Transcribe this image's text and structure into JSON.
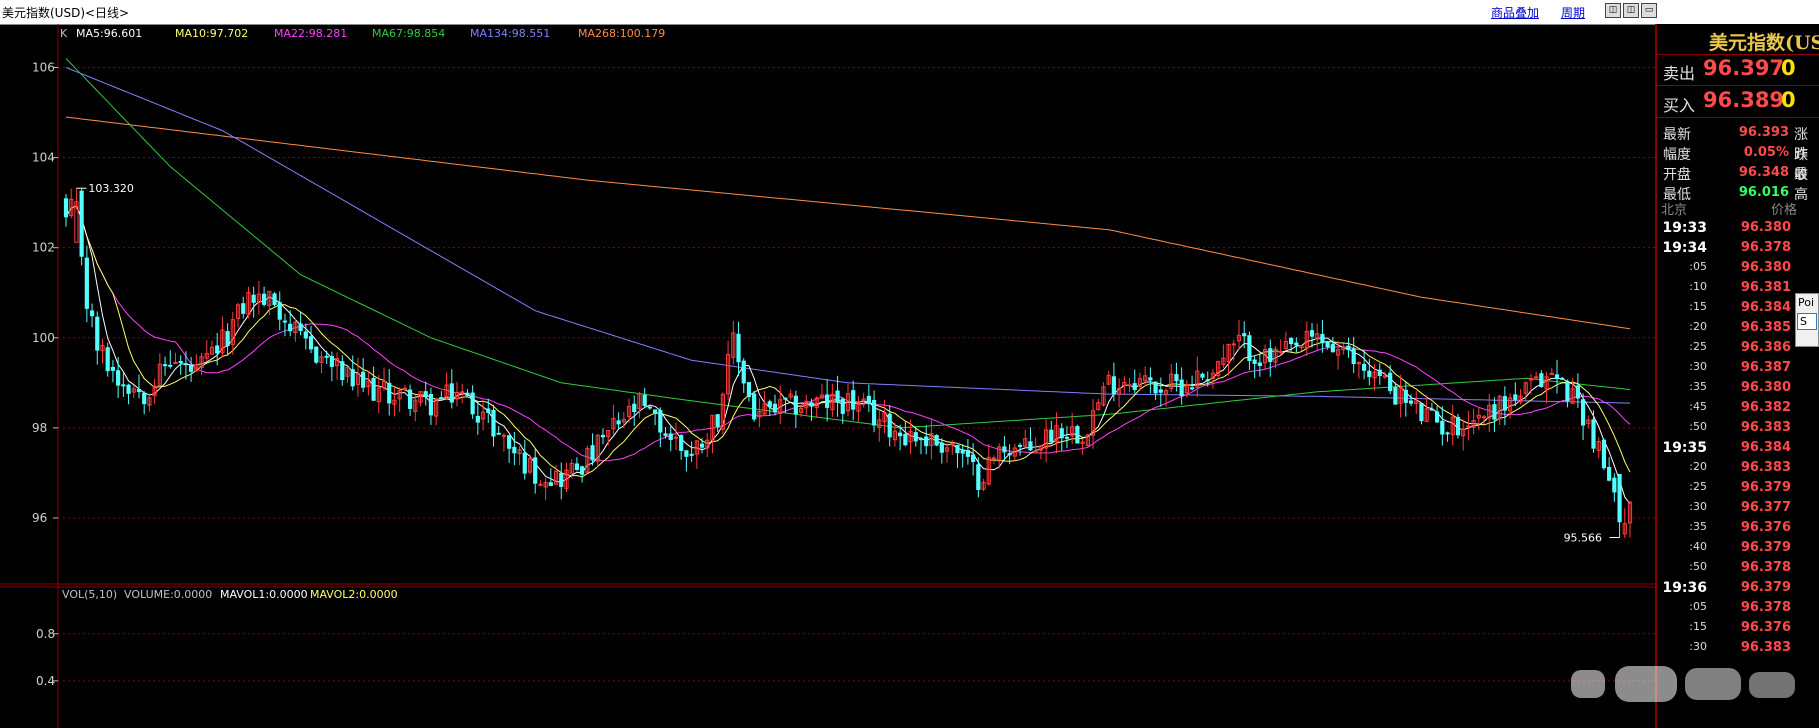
{
  "window": {
    "title": "美元指数(USD)<日线>",
    "link_overlay": "商品叠加",
    "link_period": "周期",
    "winbtn_a": "◫",
    "winbtn_b": "◫",
    "winbtn_c": "▭"
  },
  "main_legend": {
    "k": "K",
    "ma5": "MA5:96.601",
    "ma10": "MA10:97.702",
    "ma22": "MA22:98.281",
    "ma67": "MA67:98.854",
    "ma134": "MA134:98.551",
    "ma268": "MA268:100.179"
  },
  "vol_legend": {
    "vol": "VOL(5,10)",
    "volume": "VOLUME:0.0000",
    "mavol1": "MAVOL1:0.0000",
    "mavol2": "MAVOL2:0.0000"
  },
  "colors": {
    "up": "#ff3b3b",
    "down": "#54ffff",
    "ma5": "#ffffff",
    "ma10": "#ffff66",
    "ma22": "#ff40ff",
    "ma67": "#2ecc40",
    "ma134": "#8080ff",
    "ma268": "#ff8c42",
    "grid": "#8a0000",
    "price_up": "#ff4a4a",
    "price_down": "#33ff66",
    "vol_yellow": "#ffe000"
  },
  "chart_data": {
    "type": "candlestick",
    "title": "美元指数(USD)<日线>",
    "y_ticks": [
      96,
      98,
      100,
      102,
      104,
      106
    ],
    "ylim": [
      94.8,
      106.3
    ],
    "high_marker": {
      "label": "103.320",
      "value": 103.32,
      "index": 2
    },
    "low_marker": {
      "label": "95.566",
      "value": 95.566,
      "index": 298
    },
    "volume_ticks": [
      0.4,
      0.8
    ],
    "ma_anchors": {
      "MA268": [
        [
          0,
          104.9
        ],
        [
          100,
          103.5
        ],
        [
          200,
          102.4
        ],
        [
          260,
          100.9
        ],
        [
          300,
          100.2
        ]
      ],
      "MA134": [
        [
          0,
          106.0
        ],
        [
          30,
          104.6
        ],
        [
          60,
          102.6
        ],
        [
          90,
          100.6
        ],
        [
          120,
          99.5
        ],
        [
          150,
          99.0
        ],
        [
          200,
          98.75
        ],
        [
          240,
          98.7
        ],
        [
          300,
          98.55
        ]
      ],
      "MA67": [
        [
          0,
          106.2
        ],
        [
          20,
          103.8
        ],
        [
          45,
          101.4
        ],
        [
          70,
          100.0
        ],
        [
          95,
          99.0
        ],
        [
          120,
          98.6
        ],
        [
          160,
          98.0
        ],
        [
          200,
          98.3
        ],
        [
          240,
          98.8
        ],
        [
          280,
          99.1
        ],
        [
          300,
          98.85
        ]
      ]
    },
    "close_anchors": [
      [
        0,
        102.6
      ],
      [
        2,
        103.0
      ],
      [
        4,
        100.8
      ],
      [
        6,
        99.8
      ],
      [
        10,
        99.1
      ],
      [
        15,
        98.8
      ],
      [
        20,
        99.5
      ],
      [
        25,
        99.2
      ],
      [
        30,
        99.9
      ],
      [
        35,
        100.9
      ],
      [
        40,
        100.8
      ],
      [
        45,
        99.9
      ],
      [
        50,
        99.5
      ],
      [
        55,
        99.0
      ],
      [
        60,
        98.8
      ],
      [
        65,
        98.7
      ],
      [
        70,
        98.5
      ],
      [
        75,
        98.8
      ],
      [
        80,
        98.3
      ],
      [
        85,
        97.6
      ],
      [
        90,
        97.0
      ],
      [
        95,
        96.9
      ],
      [
        100,
        97.3
      ],
      [
        105,
        98.0
      ],
      [
        110,
        98.5
      ],
      [
        115,
        97.9
      ],
      [
        120,
        97.4
      ],
      [
        125,
        98.3
      ],
      [
        128,
        99.9
      ],
      [
        132,
        98.3
      ],
      [
        140,
        98.5
      ],
      [
        150,
        98.6
      ],
      [
        160,
        97.9
      ],
      [
        170,
        97.6
      ],
      [
        175,
        96.9
      ],
      [
        180,
        97.6
      ],
      [
        185,
        97.5
      ],
      [
        190,
        98.0
      ],
      [
        195,
        97.9
      ],
      [
        200,
        99.0
      ],
      [
        205,
        99.1
      ],
      [
        210,
        98.9
      ],
      [
        215,
        99.0
      ],
      [
        220,
        99.3
      ],
      [
        225,
        99.9
      ],
      [
        230,
        99.5
      ],
      [
        235,
        99.7
      ],
      [
        240,
        100.0
      ],
      [
        245,
        99.6
      ],
      [
        250,
        99.3
      ],
      [
        255,
        98.8
      ],
      [
        260,
        98.3
      ],
      [
        265,
        98.0
      ],
      [
        270,
        98.2
      ],
      [
        275,
        98.5
      ],
      [
        280,
        98.8
      ],
      [
        285,
        99.2
      ],
      [
        290,
        98.6
      ],
      [
        293,
        97.8
      ],
      [
        296,
        96.8
      ],
      [
        298,
        95.9
      ],
      [
        300,
        96.39
      ]
    ]
  },
  "quote_panel": {
    "title": "美元指数(US",
    "sell_label": "卖出",
    "sell_price": "96.397",
    "sell_vol": "0",
    "buy_label": "买入",
    "buy_price": "96.389",
    "buy_vol": "0",
    "latest_label": "最新",
    "latest_val": "96.393",
    "chg_label": "涨跌",
    "range_label": "幅度",
    "range_val": "0.05%",
    "prev_label": "昨收",
    "open_label": "开盘",
    "open_val": "96.348",
    "high_label": "最高",
    "low_label": "最低",
    "low_val": "96.016",
    "col_time": "北京",
    "col_price": "价格",
    "ticks": [
      {
        "time": "19:33",
        "price": "96.380",
        "big": true
      },
      {
        "time": "19:34",
        "price": "96.378",
        "big": true
      },
      {
        "time": ":05",
        "price": "96.380",
        "big": false
      },
      {
        "time": ":10",
        "price": "96.381",
        "big": false
      },
      {
        "time": ":15",
        "price": "96.384",
        "big": false
      },
      {
        "time": ":20",
        "price": "96.385",
        "big": false
      },
      {
        "time": ":25",
        "price": "96.386",
        "big": false
      },
      {
        "time": ":30",
        "price": "96.387",
        "big": false
      },
      {
        "time": ":35",
        "price": "96.380",
        "big": false
      },
      {
        "time": ":45",
        "price": "96.382",
        "big": false
      },
      {
        "time": ":50",
        "price": "96.383",
        "big": false
      },
      {
        "time": "19:35",
        "price": "96.384",
        "big": true
      },
      {
        "time": ":20",
        "price": "96.383",
        "big": false
      },
      {
        "time": ":25",
        "price": "96.379",
        "big": false
      },
      {
        "time": ":30",
        "price": "96.377",
        "big": false
      },
      {
        "time": ":35",
        "price": "96.376",
        "big": false
      },
      {
        "time": ":40",
        "price": "96.379",
        "big": false
      },
      {
        "time": ":50",
        "price": "96.378",
        "big": false
      },
      {
        "time": "19:36",
        "price": "96.379",
        "big": true
      },
      {
        "time": ":05",
        "price": "96.378",
        "big": false
      },
      {
        "time": ":15",
        "price": "96.376",
        "big": false
      },
      {
        "time": ":30",
        "price": "96.383",
        "big": false
      }
    ]
  },
  "side_popup": {
    "line1": "Poi",
    "line2": "S"
  }
}
